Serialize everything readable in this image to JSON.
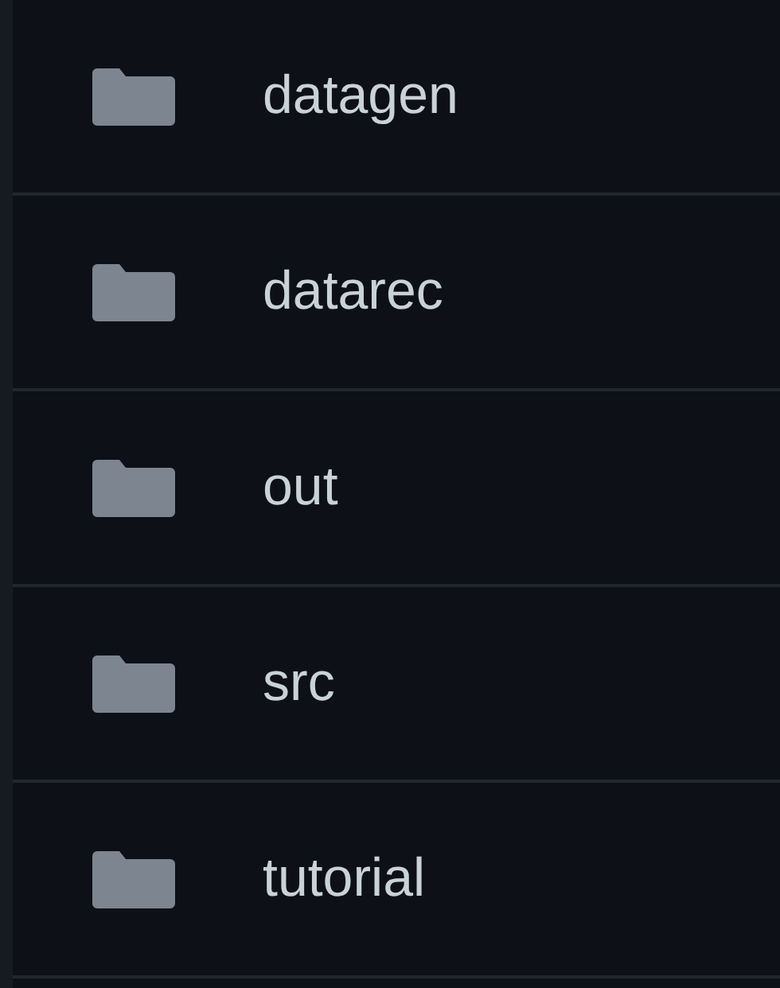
{
  "files": [
    {
      "kind": "folder",
      "name": "datagen"
    },
    {
      "kind": "folder",
      "name": "datarec"
    },
    {
      "kind": "folder",
      "name": "out"
    },
    {
      "kind": "folder",
      "name": "src"
    },
    {
      "kind": "folder",
      "name": "tutorial"
    }
  ]
}
